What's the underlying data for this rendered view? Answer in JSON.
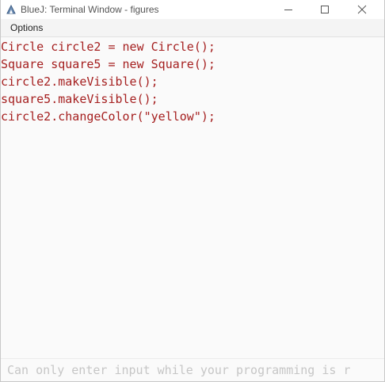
{
  "window": {
    "title": "BlueJ: Terminal Window - figures",
    "icon": "bluej-icon"
  },
  "menu": {
    "items": [
      "Options"
    ]
  },
  "output": {
    "lines": [
      "Circle circle2 = new Circle();",
      "Square square5 = new Square();",
      "circle2.makeVisible();",
      "square5.makeVisible();",
      "circle2.changeColor(\"yellow\");"
    ],
    "text_color": "#a51f1f"
  },
  "input": {
    "placeholder": "Can only enter input while your programming is r",
    "value": ""
  },
  "colors": {
    "title_text": "#555555",
    "background": "#fafafa",
    "placeholder": "#c6c6c6"
  }
}
